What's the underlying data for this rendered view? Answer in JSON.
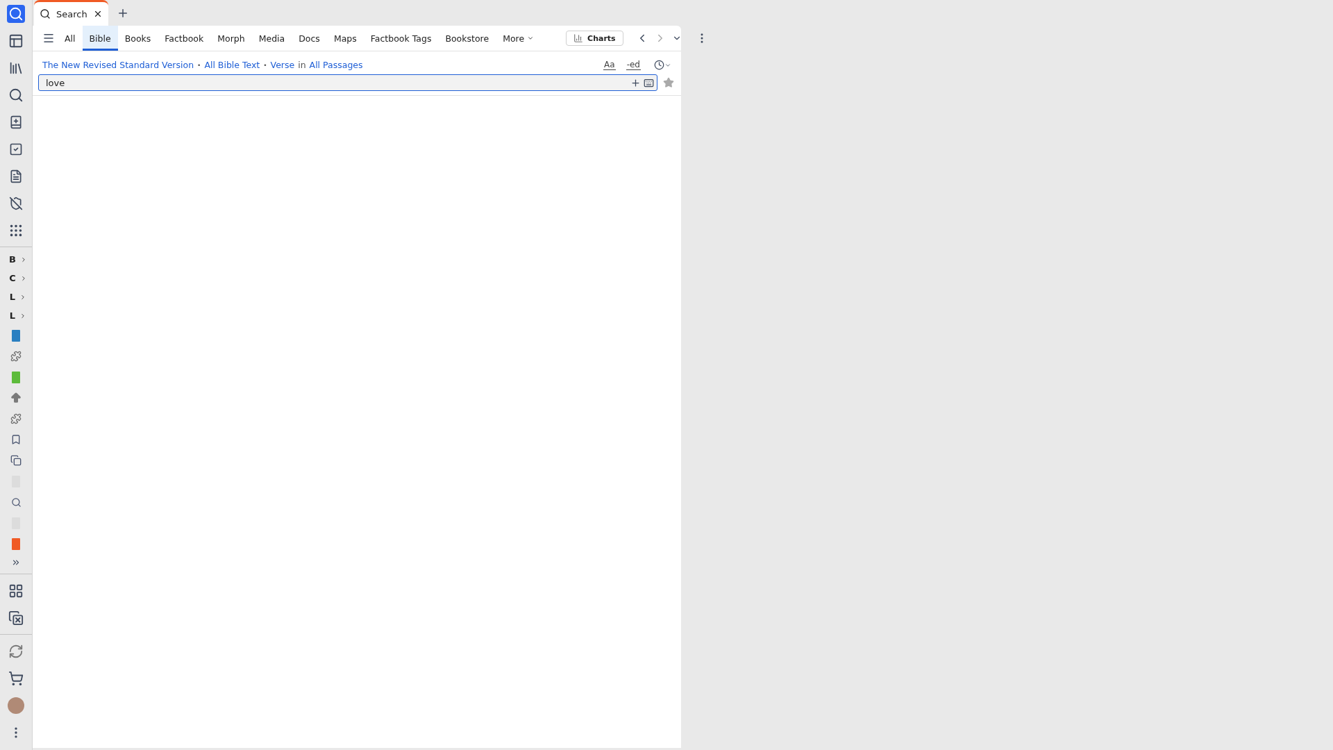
{
  "sidebar": {
    "shortcuts": [
      {
        "label": "B"
      },
      {
        "label": "C"
      },
      {
        "label": "L"
      },
      {
        "label": "L"
      }
    ]
  },
  "tabs": [
    {
      "label": "Search",
      "selected": true
    }
  ],
  "search_panel": {
    "categories": [
      {
        "label": "All",
        "selected": false
      },
      {
        "label": "Bible",
        "selected": true
      },
      {
        "label": "Books",
        "selected": false
      },
      {
        "label": "Factbook",
        "selected": false
      },
      {
        "label": "Morph",
        "selected": false
      },
      {
        "label": "Media",
        "selected": false
      },
      {
        "label": "Docs",
        "selected": false
      },
      {
        "label": "Maps",
        "selected": false
      },
      {
        "label": "Factbook Tags",
        "selected": false
      },
      {
        "label": "Bookstore",
        "selected": false
      }
    ],
    "more_menu": "More",
    "charts_button": "Charts",
    "scope": [
      {
        "kind": "link",
        "text": "The New Revised Standard Version"
      },
      {
        "kind": "separator",
        "text": "•"
      },
      {
        "kind": "link",
        "text": "All Bible Text"
      },
      {
        "kind": "separator",
        "text": "•"
      },
      {
        "kind": "link",
        "text": "Verse"
      },
      {
        "kind": "plain",
        "text": "in"
      },
      {
        "kind": "link",
        "text": "All Passages"
      }
    ],
    "options": [
      "Aa",
      "-ed"
    ],
    "query": "love"
  }
}
